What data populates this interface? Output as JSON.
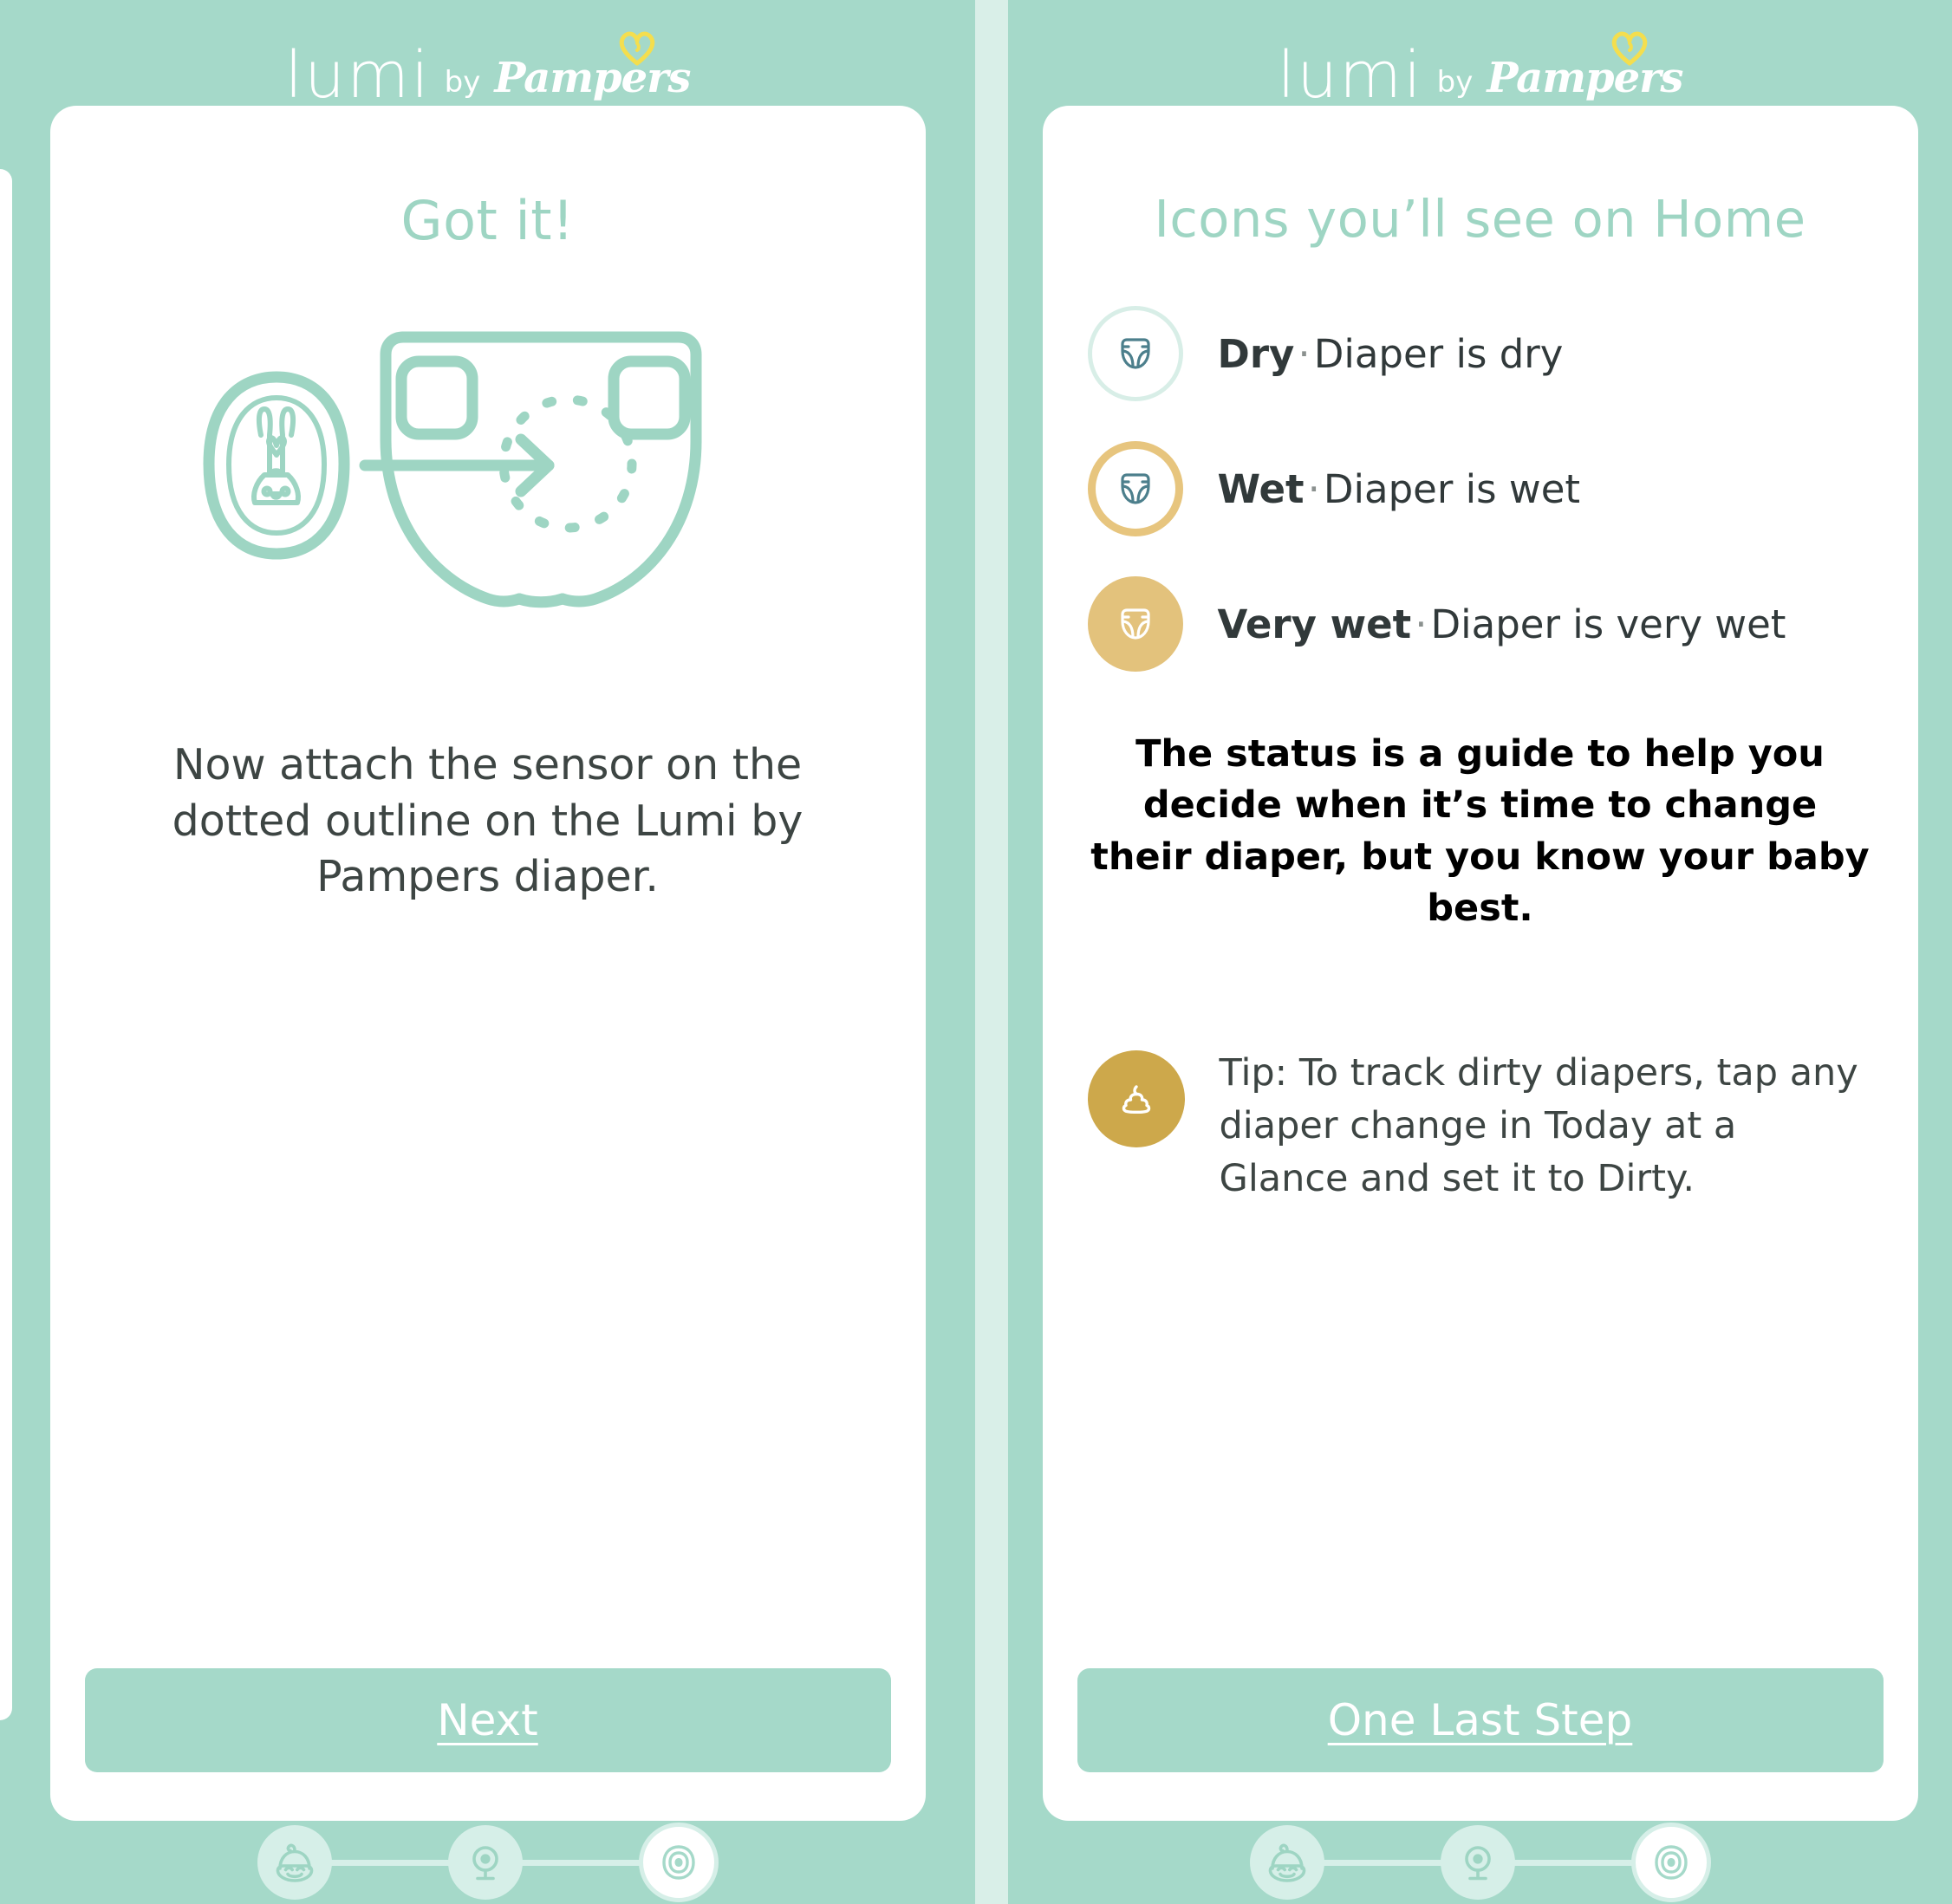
{
  "brand": {
    "lumi": "lumi",
    "by": "by",
    "pampers": "Pampers",
    "heart_icon": "heart-icon",
    "heart_color": "#f4de4e"
  },
  "theme": {
    "background": "#a5d9c9",
    "card": "#ffffff",
    "mint": "#9ed5c3",
    "mint_light": "#d6efe8",
    "teal_icon": "#4c7f8c",
    "gold": "#e3c27c",
    "gold_dark": "#cda84b",
    "text": "#3d4543"
  },
  "left_screen": {
    "title": "Got it!",
    "illustration": {
      "sensor_icon": "lumi-sensor-pod-icon",
      "arrow_icon": "arrow-right-icon",
      "diaper_icon": "diaper-outline-icon",
      "target_icon": "dotted-circle-target-icon"
    },
    "body": "Now attach the sensor on the dotted outline on the Lumi by Pampers diaper.",
    "cta": "Next"
  },
  "right_screen": {
    "title": "Icons you’ll see on Home",
    "statuses": [
      {
        "icon": "diaper-dry-icon",
        "label": "Dry",
        "separator": "·",
        "description": "Diaper is dry"
      },
      {
        "icon": "diaper-wet-icon",
        "label": "Wet",
        "separator": "·",
        "description": "Diaper is wet"
      },
      {
        "icon": "diaper-very-wet-icon",
        "label": "Very wet",
        "separator": "·",
        "description": "Diaper is very wet"
      }
    ],
    "note": "The status is a guide to help you decide when it’s time to change their diaper, but you know your baby best.",
    "tip": {
      "icon": "poop-dirty-diaper-icon",
      "text": "Tip: To track dirty diapers, tap any diaper change in Today at a Glance and set it to Dirty."
    },
    "cta": "One Last Step"
  },
  "stepper": {
    "steps": [
      {
        "icon": "baby-face-icon",
        "state": "complete"
      },
      {
        "icon": "camera-monitor-icon",
        "state": "complete"
      },
      {
        "icon": "sensor-ring-icon",
        "state": "active"
      }
    ]
  }
}
